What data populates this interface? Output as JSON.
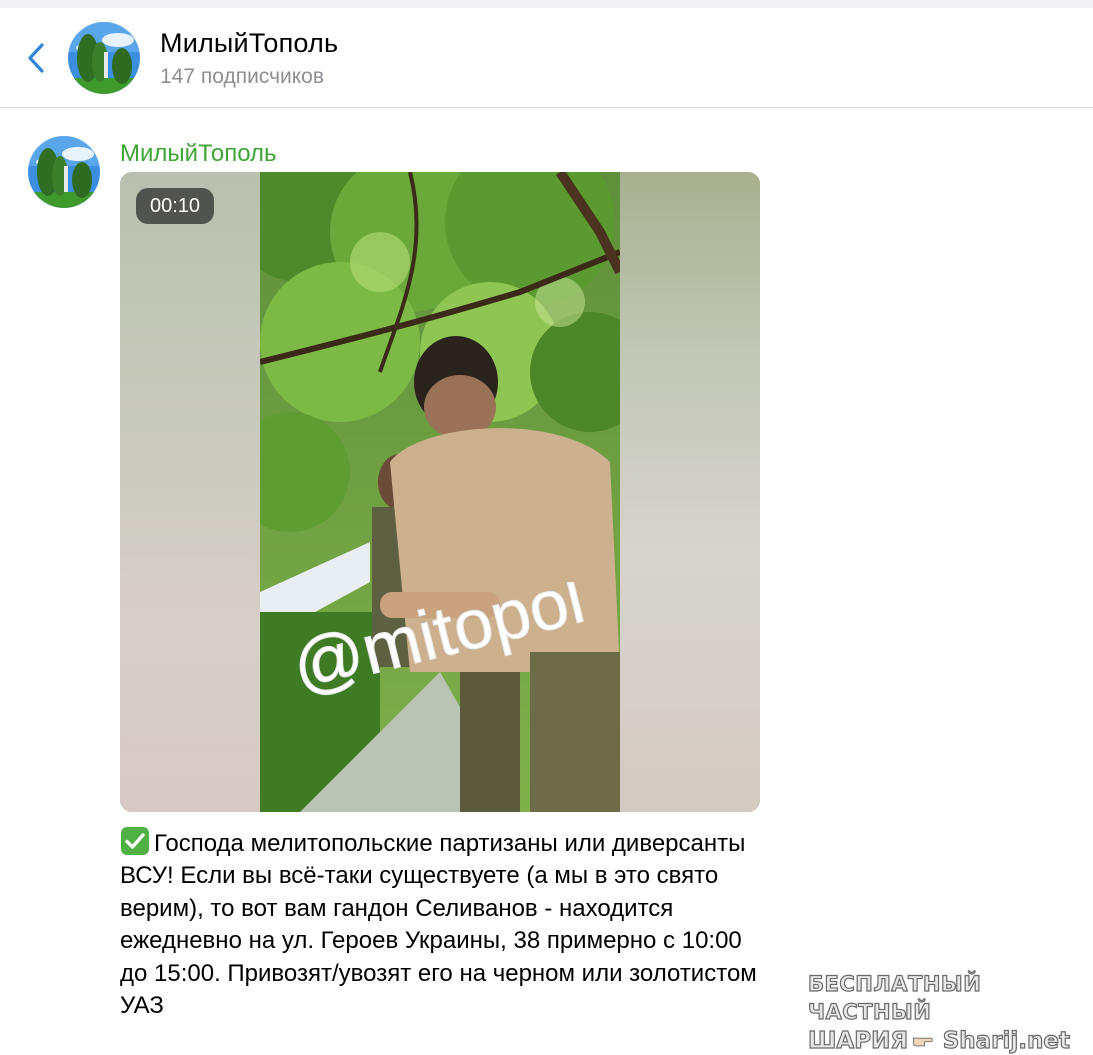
{
  "header": {
    "title": "МилыйТополь",
    "subscribers": "147 подписчиков",
    "back_icon": "chevron-left-icon",
    "accent_color": "#2f86d8"
  },
  "message": {
    "sender": "МилыйТополь",
    "sender_color": "#3fa535",
    "video": {
      "duration": "00:10",
      "overlay_text": "@mitopol"
    },
    "caption_icon": "check-mark-button-icon",
    "caption": "Господа мелитопольские партизаны или диверсанты ВСУ! Если вы всё-таки существуете (а мы в это свято верим), то вот вам гандон Селиванов - находится ежедневно на ул. Героев Украины, 38 примерно с 10:00 до 15:00. Привозят/увозят его на черном или золотистом УАЗ"
  },
  "watermark": {
    "line1": "БЕСПЛАТНЫЙ ЧАСТНЫЙ",
    "line2_left": "ШАРИЯ",
    "line2_right": "Sharij.net"
  }
}
